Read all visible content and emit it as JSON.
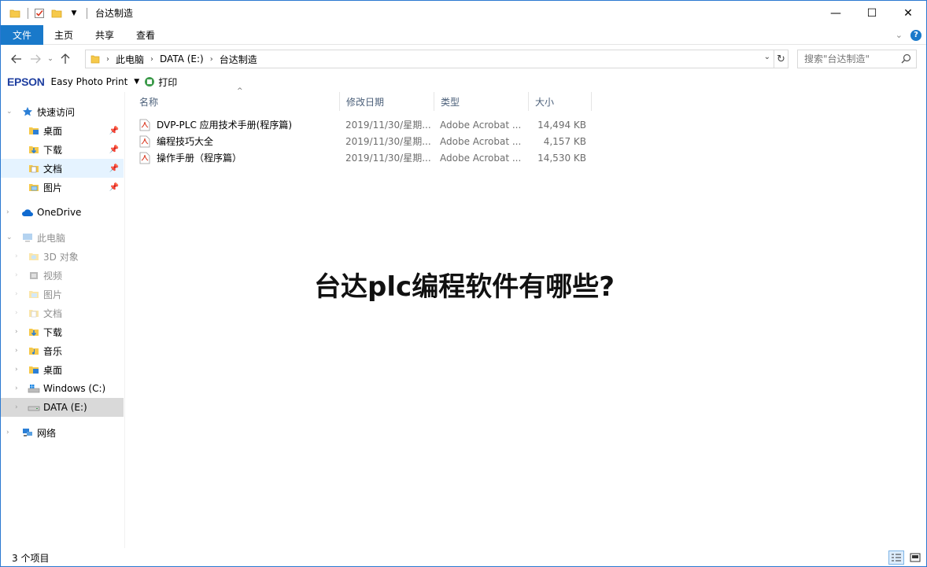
{
  "window": {
    "title": "台达制造",
    "controls": {
      "minimize": "—",
      "maximize": "☐",
      "close": "✕"
    }
  },
  "ribbon": {
    "tabs": [
      "文件",
      "主页",
      "共享",
      "查看"
    ],
    "help": "?"
  },
  "address": {
    "crumbs": [
      "此电脑",
      "DATA (E:)",
      "台达制造"
    ],
    "search_placeholder": "搜索\"台达制造\""
  },
  "epson": {
    "logo": "EPSON",
    "app": "Easy Photo Print",
    "print_label": "打印"
  },
  "sidebar": {
    "quick_access": "快速访问",
    "quick_items": [
      "桌面",
      "下载",
      "文档",
      "图片"
    ],
    "onedrive": "OneDrive",
    "this_pc": "此电脑",
    "pc_items": [
      "3D 对象",
      "视频",
      "图片",
      "文档",
      "下载",
      "音乐",
      "桌面",
      "Windows (C:)",
      "DATA (E:)"
    ],
    "network": "网络"
  },
  "columns": {
    "name": "名称",
    "date": "修改日期",
    "type": "类型",
    "size": "大小"
  },
  "files": [
    {
      "name": "DVP-PLC 应用技术手册(程序篇)",
      "date": "2019/11/30/星期...",
      "type": "Adobe Acrobat ...",
      "size": "14,494 KB"
    },
    {
      "name": "编程技巧大全",
      "date": "2019/11/30/星期...",
      "type": "Adobe Acrobat ...",
      "size": "4,157 KB"
    },
    {
      "name": "操作手册（程序篇）",
      "date": "2019/11/30/星期...",
      "type": "Adobe Acrobat ...",
      "size": "14,530 KB"
    }
  ],
  "overlay_title": "台达plc编程软件有哪些?",
  "status": {
    "count": "3 个项目"
  },
  "colors": {
    "accent": "#1979ca",
    "selection": "#e5f3ff",
    "header_text": "#4c607a"
  }
}
